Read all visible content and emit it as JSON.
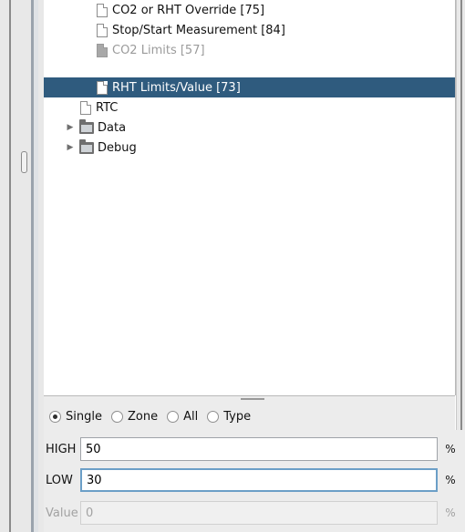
{
  "tree": {
    "items": [
      {
        "label": "CO2 or RHT Override [75]",
        "icon": "document-icon",
        "state": "normal"
      },
      {
        "label": "Stop/Start Measurement [84]",
        "icon": "document-icon",
        "state": "normal"
      },
      {
        "label": "CO2 Limits [57]",
        "icon": "document-icon",
        "state": "disabled"
      },
      {
        "label": "RHT Limits/Value [73]",
        "icon": "document-icon",
        "state": "selected"
      },
      {
        "label": "RTC",
        "icon": "document-icon",
        "state": "normal"
      },
      {
        "label": "Data",
        "icon": "folder-icon",
        "state": "collapsed"
      },
      {
        "label": "Debug",
        "icon": "folder-icon",
        "state": "collapsed"
      }
    ]
  },
  "mode": {
    "options": [
      "Single",
      "Zone",
      "All",
      "Type"
    ],
    "selected": "Single"
  },
  "fields": {
    "high": {
      "label": "HIGH",
      "value": "50",
      "unit": "%"
    },
    "low": {
      "label": "LOW",
      "value": "30",
      "unit": "%"
    },
    "value": {
      "label": "Value",
      "value": "0",
      "unit": "%"
    }
  },
  "colors": {
    "selection": "#2f5b7e",
    "focus_border": "#6b9fc7"
  }
}
